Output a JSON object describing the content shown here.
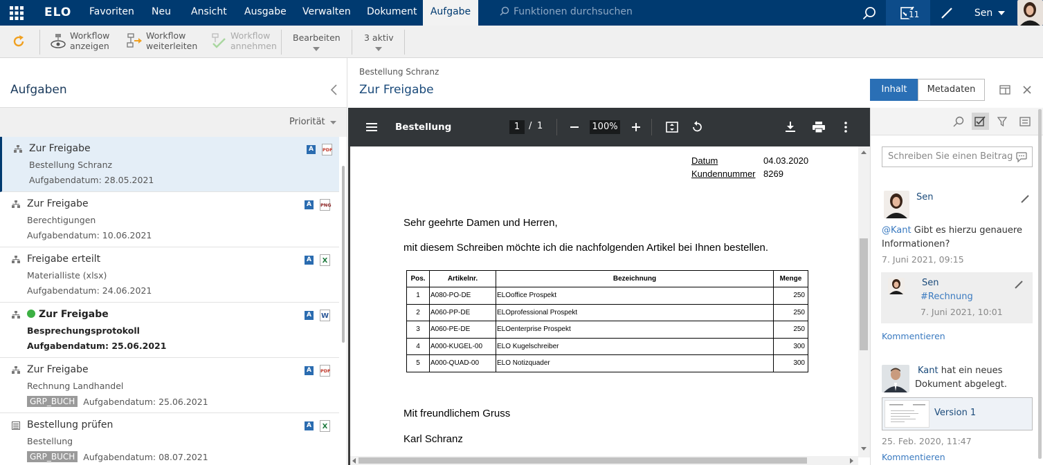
{
  "topbar": {
    "logo": "ELO",
    "menu": [
      "Favoriten",
      "Neu",
      "Ansicht",
      "Ausgabe",
      "Verwalten",
      "Dokument",
      "Aufgabe"
    ],
    "active_menu": "Aufgabe",
    "search_placeholder": "Funktionen durchsuchen",
    "task_count": "11",
    "user": "Sen"
  },
  "ribbon": {
    "show_workflow": [
      "Workflow",
      "anzeigen"
    ],
    "forward_workflow": [
      "Workflow",
      "weiterleiten"
    ],
    "accept_workflow": [
      "Workflow",
      "annehmen"
    ],
    "edit": "Bearbeiten",
    "active": "3 aktiv"
  },
  "tasks_panel": {
    "title": "Aufgaben",
    "sort_label": "Priorität",
    "items": [
      {
        "title": "Zur Freigabe",
        "subtitle": "Bestellung Schranz",
        "date": "Aufgabendatum: 28.05.2021",
        "file": "PDF"
      },
      {
        "title": "Zur Freigabe",
        "subtitle": "Berechtigungen",
        "date": "Aufgabendatum: 10.06.2021",
        "file": "PNG"
      },
      {
        "title": "Freigabe erteilt",
        "subtitle": "Materialliste (xlsx)",
        "date": "Aufgabendatum: 24.06.2021",
        "file": "X"
      },
      {
        "title": "Zur Freigabe",
        "subtitle": "Besprechungsprotokoll",
        "date": "Aufgabendatum: 25.06.2021",
        "file": "W"
      },
      {
        "title": "Zur Freigabe",
        "subtitle": "Rechnung Landhandel",
        "group": "GRP_BUCH",
        "date": "Aufgabendatum: 25.06.2021",
        "file": "PDF"
      },
      {
        "title": "Bestellung prüfen",
        "subtitle": "Bestellung",
        "group": "GRP_BUCH",
        "date": "Aufgabendatum: 08.07.2021",
        "file": "X"
      }
    ],
    "badge_letter": "A"
  },
  "document": {
    "breadcrumb": "Bestellung Schranz",
    "title": "Zur Freigabe",
    "tab_content": "Inhalt",
    "tab_metadata": "Metadaten"
  },
  "pdf_viewer": {
    "doc_name": "Bestellung",
    "page_current": "1",
    "page_sep": "/",
    "page_total": "1",
    "zoom": "100%"
  },
  "letter": {
    "date_label": "Datum",
    "date_value": "04.03.2020",
    "customer_label": "Kundennummer",
    "customer_value": "8269",
    "salutation": "Sehr geehrte Damen und Herren,",
    "body": "mit diesem Schreiben möchte ich die nachfolgenden Artikel bei Ihnen bestellen.",
    "table_headers": [
      "Pos.",
      "Artikelnr.",
      "Bezeichnung",
      "Menge"
    ],
    "rows": [
      [
        "1",
        "A080-PO-DE",
        "ELOoffice Prospekt",
        "250"
      ],
      [
        "2",
        "A060-PP-DE",
        "ELOprofessional Prospekt",
        "250"
      ],
      [
        "3",
        "A060-PE-DE",
        "ELOenterprise Prospekt",
        "250"
      ],
      [
        "4",
        "A000-KUGEL-00",
        "ELO Kugelschreiber",
        "300"
      ],
      [
        "5",
        "A000-QUAD-00",
        "ELO Notizquader",
        "300"
      ]
    ],
    "closing": "Mit freundlichem Gruss",
    "signature": "Karl Schranz"
  },
  "feed": {
    "input_placeholder": "Schreiben Sie einen Beitrag",
    "post1": {
      "author": "Sen",
      "mention": "@Kant",
      "text": "Gibt es hierzu genauere Informationen?",
      "time": "7. Juni 2021, 09:15"
    },
    "reply1": {
      "author": "Sen",
      "tag": "#Rechnung",
      "time": "7. Juni 2021, 10:01"
    },
    "comment_link": "Kommentieren",
    "post2": {
      "author": "Kant",
      "text": "hat ein neues Dokument abgelegt.",
      "version": "Version 1",
      "time": "25. Feb. 2020, 11:47"
    },
    "comment_link2": "Kommentieren"
  }
}
